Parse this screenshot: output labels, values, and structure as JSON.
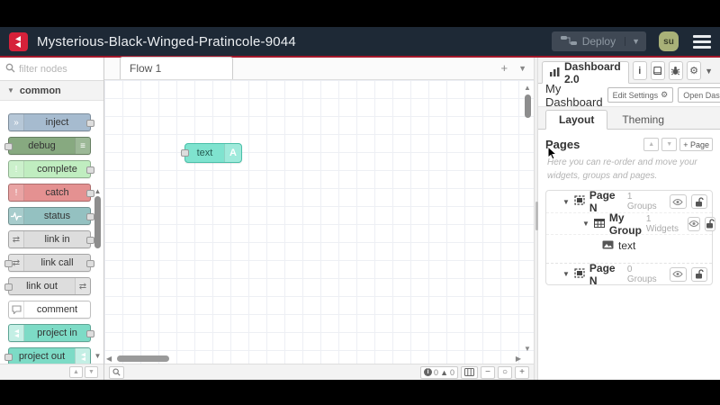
{
  "header": {
    "title": "Mysterious-Black-Winged-Pratincole-9044",
    "deploy_label": "Deploy",
    "avatar_initials": "su"
  },
  "palette": {
    "search_placeholder": "filter nodes",
    "category": "common",
    "nodes": [
      {
        "label": "inject",
        "color": "#a6bbcf"
      },
      {
        "label": "debug",
        "color": "#87a980"
      },
      {
        "label": "complete",
        "color": "#c0edc0"
      },
      {
        "label": "catch",
        "color": "#e49191"
      },
      {
        "label": "status",
        "color": "#94c1c1"
      },
      {
        "label": "link in",
        "color": "#dddddd"
      },
      {
        "label": "link call",
        "color": "#dddddd"
      },
      {
        "label": "link out",
        "color": "#dddddd"
      },
      {
        "label": "comment",
        "color": "#ffffff"
      },
      {
        "label": "project in",
        "color": "#7ddbc6"
      },
      {
        "label": "project out",
        "color": "#7ddbc6"
      }
    ]
  },
  "workspace": {
    "tab_label": "Flow 1",
    "node": {
      "label": "text",
      "color": "#7fe3cf",
      "icon_letter": "A"
    }
  },
  "statusbar": {
    "info_count": "0",
    "warning_count": "0"
  },
  "sidebar": {
    "tab_title": "Dashboard 2.0",
    "dashboard_name": "My Dashboard",
    "edit_settings_label": "Edit Settings",
    "open_dashboard_label": "Open Dashboard",
    "tab_layout": "Layout",
    "tab_theming": "Theming",
    "pages_heading": "Pages",
    "add_page_label": "+ Page",
    "hint": "Here you can re-order and move your widgets, groups and pages.",
    "tree": [
      {
        "label": "Page N",
        "meta": "1 Groups"
      },
      {
        "label": "My Group",
        "meta": "1 Widgets"
      },
      {
        "label": "text",
        "meta": ""
      },
      {
        "label": "Page N",
        "meta": "0 Groups"
      }
    ]
  }
}
